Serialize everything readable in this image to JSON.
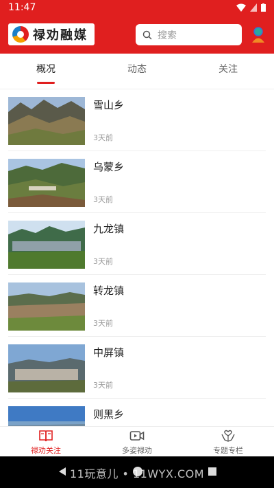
{
  "status_bar": {
    "time": "11:47"
  },
  "header": {
    "logo_text": "禄劝融媒",
    "search_placeholder": "搜索"
  },
  "tabs": [
    {
      "label": "概况"
    },
    {
      "label": "动态"
    },
    {
      "label": "关注"
    }
  ],
  "items": [
    {
      "title": "雪山乡",
      "time": "3天前"
    },
    {
      "title": "乌蒙乡",
      "time": "3天前"
    },
    {
      "title": "九龙镇",
      "time": "3天前"
    },
    {
      "title": "转龙镇",
      "time": "3天前"
    },
    {
      "title": "中屏镇",
      "time": "3天前"
    },
    {
      "title": "则黑乡",
      "time": ""
    }
  ],
  "bottom_nav": [
    {
      "label": "禄劝关注"
    },
    {
      "label": "多姿禄劝"
    },
    {
      "label": "专题专栏"
    }
  ],
  "watermark": "11玩意儿 • 11WYX.COM",
  "colors": {
    "brand_red": "#e01f1f",
    "text_main": "#222222",
    "text_muted": "#999999"
  }
}
